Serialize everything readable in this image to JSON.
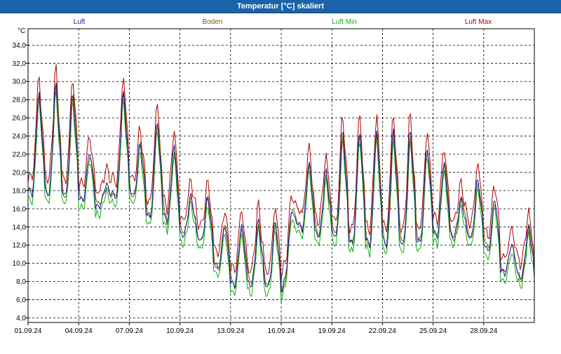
{
  "window": {
    "title": "Temperatur [°C] skaliert"
  },
  "colors": {
    "background": "#ffffff",
    "titlebar": "#1a63a8",
    "grid": "#000000",
    "luft": "#1a1a9a",
    "boden": "#7a5a00",
    "luft_min": "#10b010",
    "luft_max": "#b00000"
  },
  "chart_data": {
    "type": "line",
    "title": "Temperatur [°C] skaliert",
    "unit_label": "°C",
    "ylim": [
      3.5,
      35.8
    ],
    "yticks": [
      "4,0",
      "6,0",
      "8,0",
      "10,0",
      "12,0",
      "14,0",
      "16,0",
      "18,0",
      "20,0",
      "22,0",
      "24,0",
      "26,0",
      "28,0",
      "30,0",
      "32,0",
      "34,0"
    ],
    "x_range": [
      "2024-09-01",
      "2024-10-01"
    ],
    "xtick_labels": [
      "01.09.24",
      "04.09.24",
      "07.09.24",
      "10.09.24",
      "13.09.24",
      "16.09.24",
      "19.09.24",
      "22.09.24",
      "25.09.24",
      "28.09.24"
    ],
    "grid": true,
    "legend_position": "top",
    "daily": {
      "dates": [
        "2024-09-01",
        "2024-09-02",
        "2024-09-03",
        "2024-09-04",
        "2024-09-05",
        "2024-09-06",
        "2024-09-07",
        "2024-09-08",
        "2024-09-09",
        "2024-09-10",
        "2024-09-11",
        "2024-09-12",
        "2024-09-13",
        "2024-09-14",
        "2024-09-15",
        "2024-09-16",
        "2024-09-17",
        "2024-09-18",
        "2024-09-19",
        "2024-09-20",
        "2024-09-21",
        "2024-09-22",
        "2024-09-23",
        "2024-09-24",
        "2024-09-25",
        "2024-09-26",
        "2024-09-27",
        "2024-09-28",
        "2024-09-29",
        "2024-09-30"
      ],
      "min": [
        17.5,
        17.5,
        17.5,
        17,
        16,
        17,
        18,
        15,
        15,
        13,
        13,
        10,
        7.5,
        7.5,
        7.5,
        6.5,
        14,
        13,
        13,
        12,
        12,
        12,
        12,
        12,
        13,
        13,
        13,
        12,
        9,
        8.5
      ],
      "max": [
        30,
        31,
        30,
        23,
        19,
        30,
        24,
        27,
        24,
        18,
        18,
        15,
        15,
        15.5,
        15.5,
        16.5,
        22,
        21,
        26,
        26,
        26,
        26,
        26,
        24,
        22,
        17.5,
        20,
        18,
        12.5,
        14.5
      ]
    },
    "series": [
      {
        "name": "Luft",
        "color": "#1a1a9a"
      },
      {
        "name": "Boden",
        "color": "#7a5a00"
      },
      {
        "name": "Luft Min",
        "color": "#10b010"
      },
      {
        "name": "Luft Max",
        "color": "#b00000"
      }
    ]
  }
}
